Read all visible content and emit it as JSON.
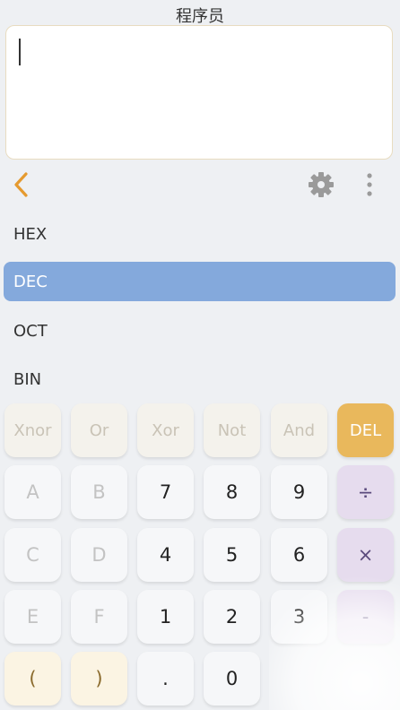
{
  "app": {
    "title": "程序员"
  },
  "bases": [
    {
      "label": "HEX"
    },
    {
      "label": "DEC"
    },
    {
      "label": "OCT"
    },
    {
      "label": "BIN"
    }
  ],
  "active_base": "DEC",
  "keys": {
    "row1": [
      "Xnor",
      "Or",
      "Xor",
      "Not",
      "And",
      "DEL"
    ],
    "row2": [
      "A",
      "B",
      "7",
      "8",
      "9",
      "÷"
    ],
    "row3": [
      "C",
      "D",
      "4",
      "5",
      "6",
      "×"
    ],
    "row4": [
      "E",
      "F",
      "1",
      "2",
      "3",
      "-"
    ],
    "row5": [
      "(",
      ")",
      ".",
      "0"
    ]
  },
  "icons": {
    "back": "chevron-left-icon",
    "settings": "gear-icon",
    "more": "more-vertical-icon"
  },
  "colors": {
    "accent": "#e59a2f",
    "active_base": "#84a9dc",
    "del_key": "#e9b85c",
    "op_key": "#e6dcee"
  }
}
